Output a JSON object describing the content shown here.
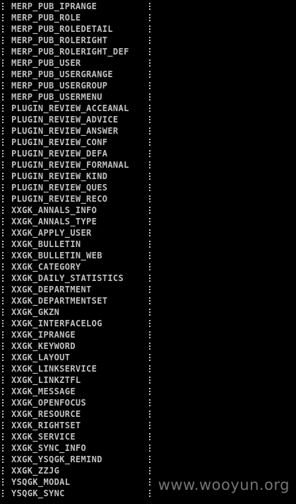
{
  "tables": [
    "MERP_PUB_IPRANGE",
    "MERP_PUB_ROLE",
    "MERP_PUB_ROLEDETAIL",
    "MERP_PUB_ROLERIGHT",
    "MERP_PUB_ROLERIGHT_DEF",
    "MERP_PUB_USER",
    "MERP_PUB_USERGRANGE",
    "MERP_PUB_USERGROUP",
    "MERP_PUB_USERMENU",
    "PLUGIN_REVIEW_ACCEANAL",
    "PLUGIN_REVIEW_ADVICE",
    "PLUGIN_REVIEW_ANSWER",
    "PLUGIN_REVIEW_CONF",
    "PLUGIN_REVIEW_DEFA",
    "PLUGIN_REVIEW_FORMANAL",
    "PLUGIN_REVIEW_KIND",
    "PLUGIN_REVIEW_QUES",
    "PLUGIN_REVIEW_RECO",
    "XXGK_ANNALS_INFO",
    "XXGK_ANNALS_TYPE",
    "XXGK_APPLY_USER",
    "XXGK_BULLETIN",
    "XXGK_BULLETIN_WEB",
    "XXGK_CATEGORY",
    "XXGK_DAILY_STATISTICS",
    "XXGK_DEPARTMENT",
    "XXGK_DEPARTMENTSET",
    "XXGK_GKZN",
    "XXGK_INTERFACELOG",
    "XXGK_IPRANGE",
    "XXGK_KEYWORD",
    "XXGK_LAYOUT",
    "XXGK_LINKSERVICE",
    "XXGK_LINKZTFL",
    "XXGK_MESSAGE",
    "XXGK_OPENFOCUS",
    "XXGK_RESOURCE",
    "XXGK_RIGHTSET",
    "XXGK_SERVICE",
    "XXGK_SYNC_INFO",
    "XXGK_YSQGK_REMIND",
    "XXGK_ZZJG",
    "YSQGK_MODAL",
    "YSQGK_SYNC"
  ],
  "watermark": "www.wooyun.org",
  "colors": {
    "background": "#000000",
    "text": "#c0c0c0",
    "watermark": "#8a8a8a"
  }
}
